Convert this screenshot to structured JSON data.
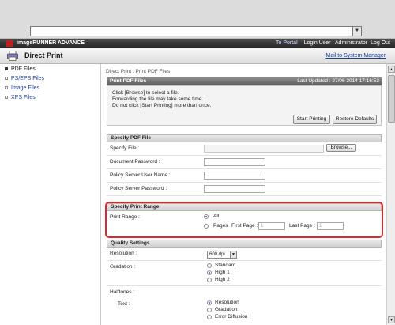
{
  "brand": {
    "title": "imageRUNNER ADVANCE",
    "to_portal": "To Portal",
    "login_user": "Login User : Administrator",
    "logout": "Log Out"
  },
  "app": {
    "title": "Direct Print",
    "mail_link": "Mail to System Manager"
  },
  "sidebar": {
    "items": [
      {
        "label": "PDF Files"
      },
      {
        "label": "PS/EPS Files"
      },
      {
        "label": "Image Files"
      },
      {
        "label": "XPS Files"
      }
    ]
  },
  "breadcrumb": "Direct Print : Print PDF Files",
  "print_panel": {
    "title": "Print PDF Files",
    "last_updated": "Last Updated : 27/06 2014 17:16:53",
    "messages": [
      "Click [Browse] to select a file.",
      "Forwarding the file may take some time.",
      "Do not click [Start Printing] more than once."
    ],
    "start_button": "Start Printing",
    "restore_button": "Restore Defaults"
  },
  "specify_file": {
    "header": "Specify PDF File",
    "rows": [
      {
        "label": "Specify File :"
      },
      {
        "label": "Document Password :"
      },
      {
        "label": "Policy Server User Name :"
      },
      {
        "label": "Policy Server Password :"
      }
    ],
    "browse_button": "Browse..."
  },
  "print_range": {
    "header": "Specify Print Range",
    "label": "Print Range :",
    "all_label": "All",
    "pages_label": "Pages",
    "first_page_label": "First Page :",
    "first_page_value": "1",
    "last_page_label": "Last Page :",
    "last_page_value": "1",
    "selected": "All"
  },
  "quality": {
    "header": "Quality Settings",
    "resolution_label": "Resolution :",
    "resolution_value": "600 dpi",
    "gradation_label": "Gradation :",
    "gradation_options": [
      "Standard",
      "High 1",
      "High 2"
    ],
    "gradation_selected": "High 1",
    "halftones_label": "Halftones :",
    "text_label": "Text :",
    "text_options": [
      "Resolution",
      "Gradation",
      "Error Diffusion"
    ],
    "text_selected": "Resolution"
  },
  "colors": {
    "highlight": "#e0262a",
    "link": "#1b3f94",
    "header_dark": "#5c5c5c"
  }
}
